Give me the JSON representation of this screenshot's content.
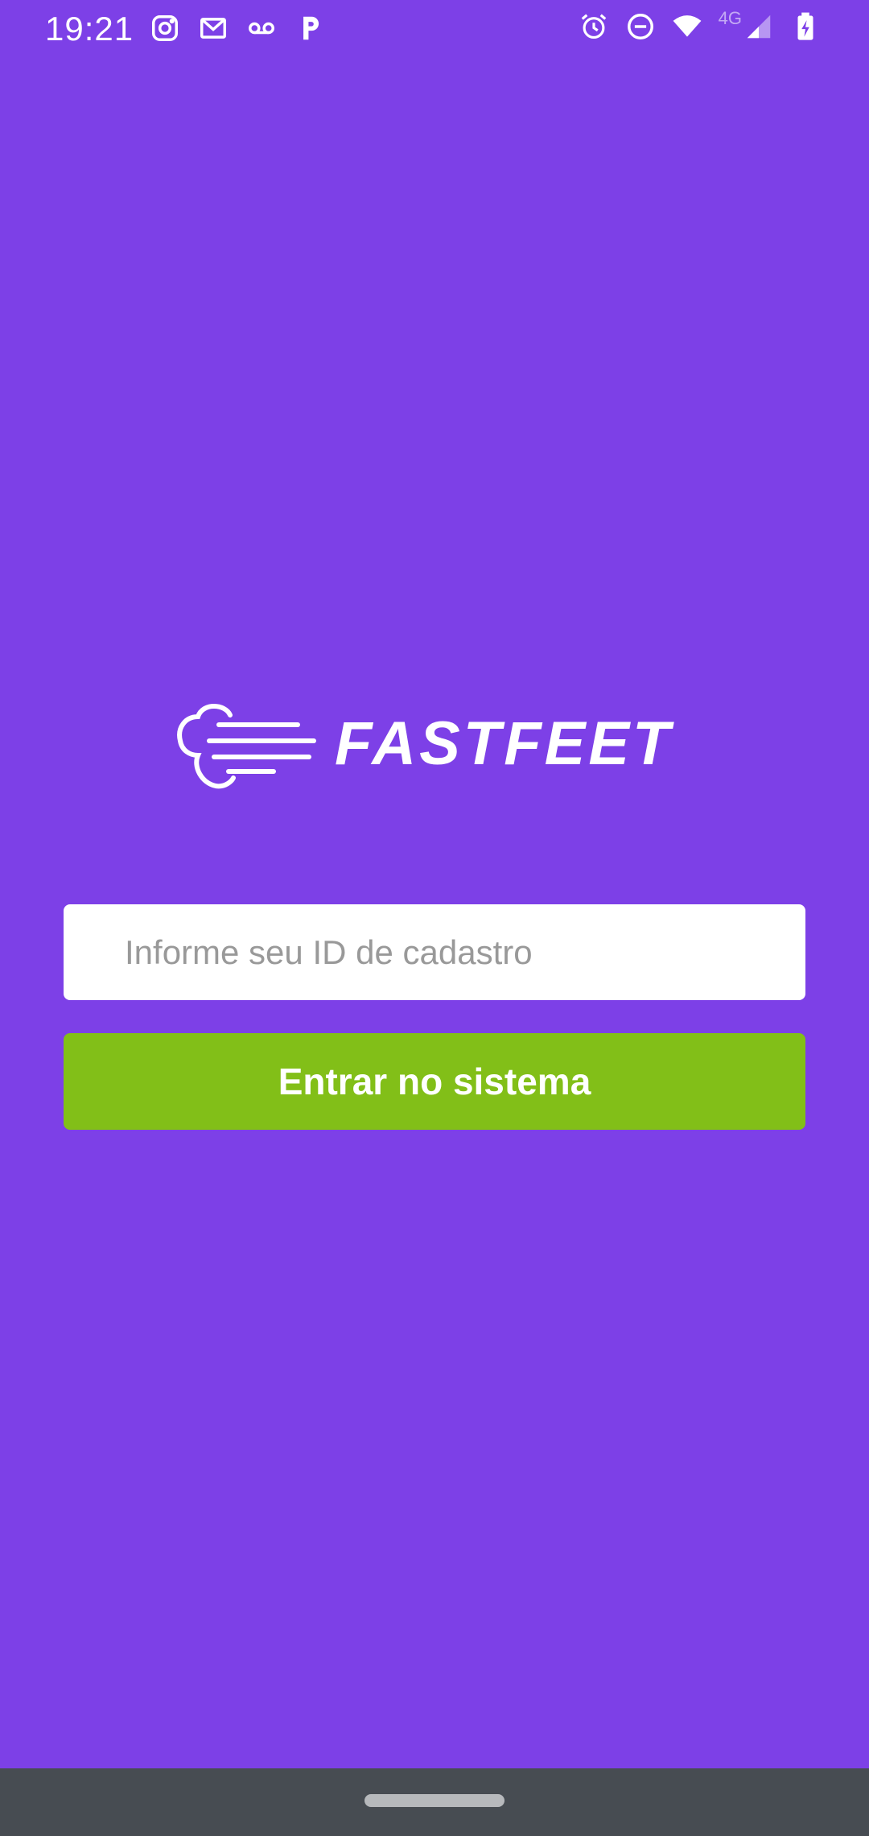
{
  "status_bar": {
    "time": "19:21",
    "left_icons": [
      "instagram-icon",
      "gmail-icon",
      "voicemail-icon",
      "p-app-icon"
    ],
    "right_icons": [
      "alarm-icon",
      "do-not-disturb-icon",
      "wifi-icon",
      "cellular-icon",
      "battery-charging-icon"
    ],
    "network_type": "4G"
  },
  "logo": {
    "icon": "wind-cloud-icon",
    "text": "FASTFEET"
  },
  "login_form": {
    "id_input": {
      "placeholder": "Informe seu ID de cadastro",
      "value": ""
    },
    "submit_label": "Entrar no sistema"
  },
  "colors": {
    "background": "#7D40E7",
    "button": "#82BF18",
    "input_background": "#FFFFFF",
    "placeholder": "#999999",
    "nav_bar": "#474C52"
  }
}
